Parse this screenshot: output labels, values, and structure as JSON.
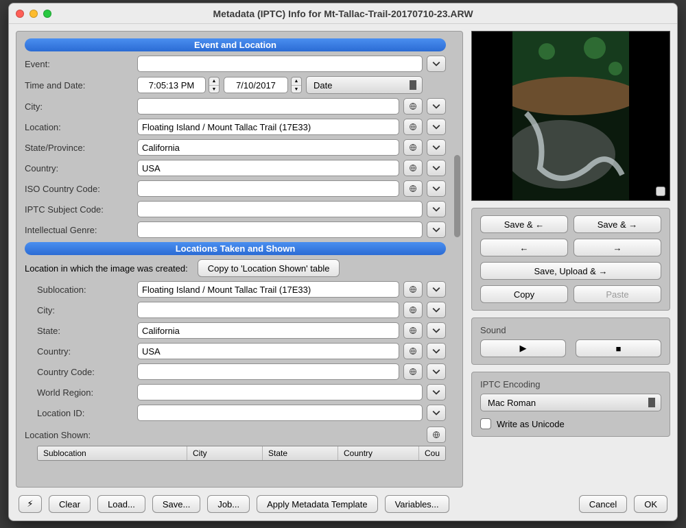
{
  "window": {
    "title": "Metadata (IPTC) Info for Mt-Tallac-Trail-20170710-23.ARW",
    "traffic": {
      "close": "#ff5f57",
      "min": "#febc2e",
      "max": "#28c840"
    }
  },
  "sections": {
    "event_location": {
      "header": "Event and Location",
      "event_label": "Event:",
      "event_value": "",
      "timedate_label": "Time and Date:",
      "time_value": "7:05:13 PM",
      "date_value": "7/10/2017",
      "date_selector": "Date",
      "city_label": "City:",
      "city_value": "",
      "location_label": "Location:",
      "location_value": "Floating Island / Mount Tallac Trail (17E33)",
      "state_label": "State/Province:",
      "state_value": "California",
      "country_label": "Country:",
      "country_value": "USA",
      "iso_label": "ISO Country Code:",
      "iso_value": "",
      "iptc_subj_label": "IPTC Subject Code:",
      "iptc_subj_value": "",
      "genre_label": "Intellectual Genre:",
      "genre_value": ""
    },
    "taken_shown": {
      "header": "Locations Taken and Shown",
      "created_label": "Location in which the image was created:",
      "copy_btn": "Copy to 'Location Shown' table",
      "sublocation_label": "Sublocation:",
      "sublocation_value": "Floating Island / Mount Tallac Trail (17E33)",
      "city_label": "City:",
      "city_value": "",
      "state_label": "State:",
      "state_value": "California",
      "country_label": "Country:",
      "country_value": "USA",
      "ccode_label": "Country Code:",
      "ccode_value": "",
      "region_label": "World Region:",
      "region_value": "",
      "locid_label": "Location ID:",
      "locid_value": "",
      "shown_label": "Location Shown:",
      "columns": {
        "sub": "Sublocation",
        "city": "City",
        "state": "State",
        "country": "Country",
        "last": "Cou"
      }
    }
  },
  "right": {
    "save_prev": "Save & ←",
    "save_next": "Save & →",
    "prev": "←",
    "next": "→",
    "save_upload": "Save, Upload & →",
    "copy": "Copy",
    "paste": "Paste",
    "sound_label": "Sound",
    "play": "▶",
    "stop": "■",
    "encoding_label": "IPTC Encoding",
    "encoding_value": "Mac Roman",
    "unicode_label": "Write as Unicode"
  },
  "footer": {
    "bolt": "⚡︎",
    "clear": "Clear",
    "load": "Load...",
    "save": "Save...",
    "job": "Job...",
    "apply": "Apply Metadata Template",
    "variables": "Variables...",
    "cancel": "Cancel",
    "ok": "OK"
  }
}
